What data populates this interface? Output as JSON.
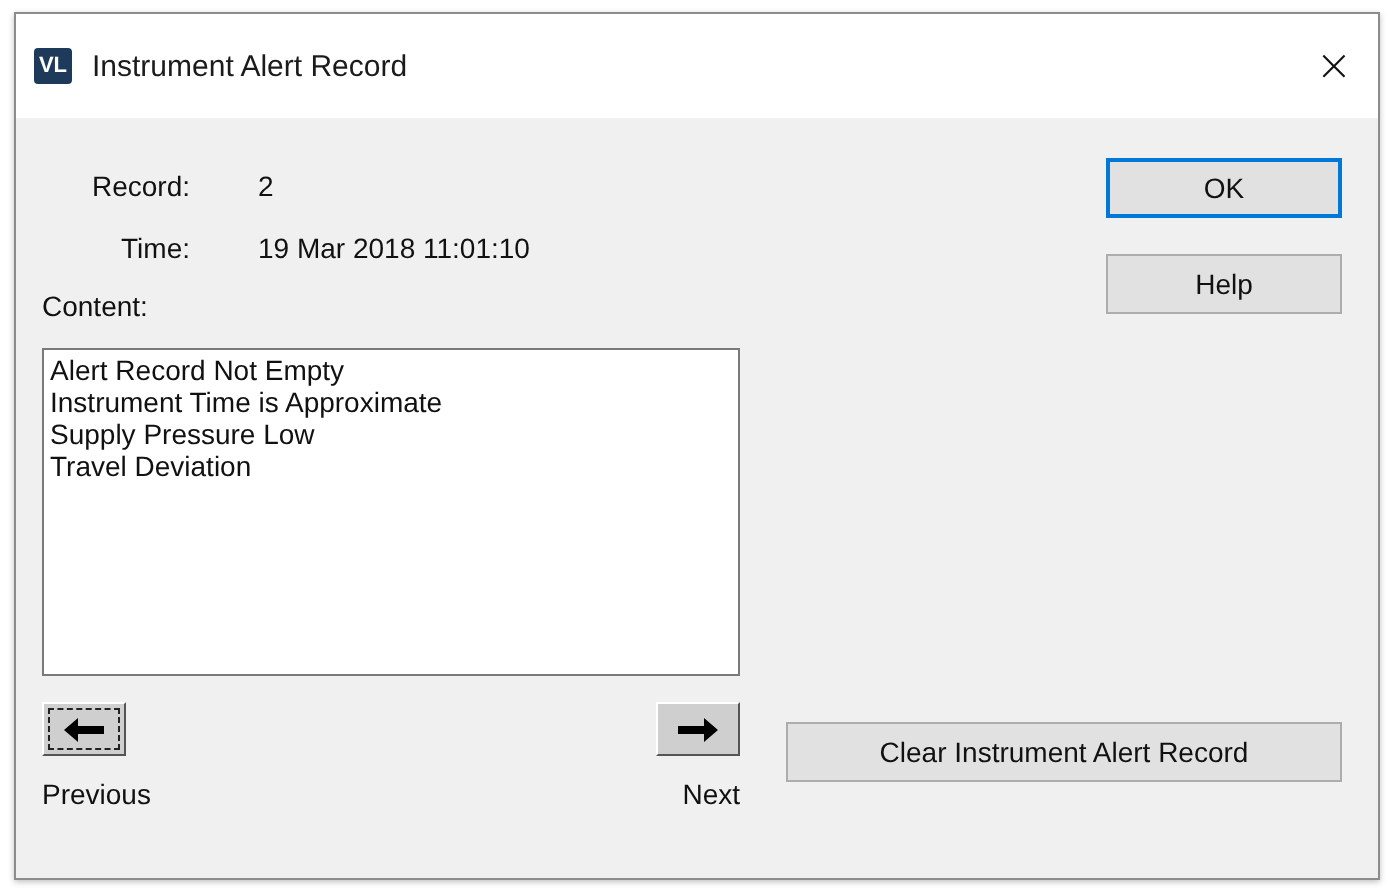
{
  "window": {
    "logo": "VL",
    "title": "Instrument Alert Record",
    "close": "×"
  },
  "fields": [
    {
      "label": "Record:",
      "value": "2"
    },
    {
      "label": "Time:",
      "value": "19 Mar 2018 11:01:10"
    }
  ],
  "content": {
    "label": "Content:",
    "lines": [
      "Alert Record Not Empty",
      "Instrument Time is Approximate",
      "Supply Pressure Low",
      "Travel Deviation"
    ]
  },
  "navigation": [
    {
      "kind": "previous",
      "label": "Previous",
      "focused": true
    },
    {
      "kind": "next",
      "label": "Next",
      "focused": false
    }
  ],
  "buttons": [
    {
      "label": "OK",
      "default": true
    },
    {
      "label": "Help",
      "default": false
    }
  ],
  "clear_button": {
    "label": "Clear Instrument Alert Record"
  }
}
